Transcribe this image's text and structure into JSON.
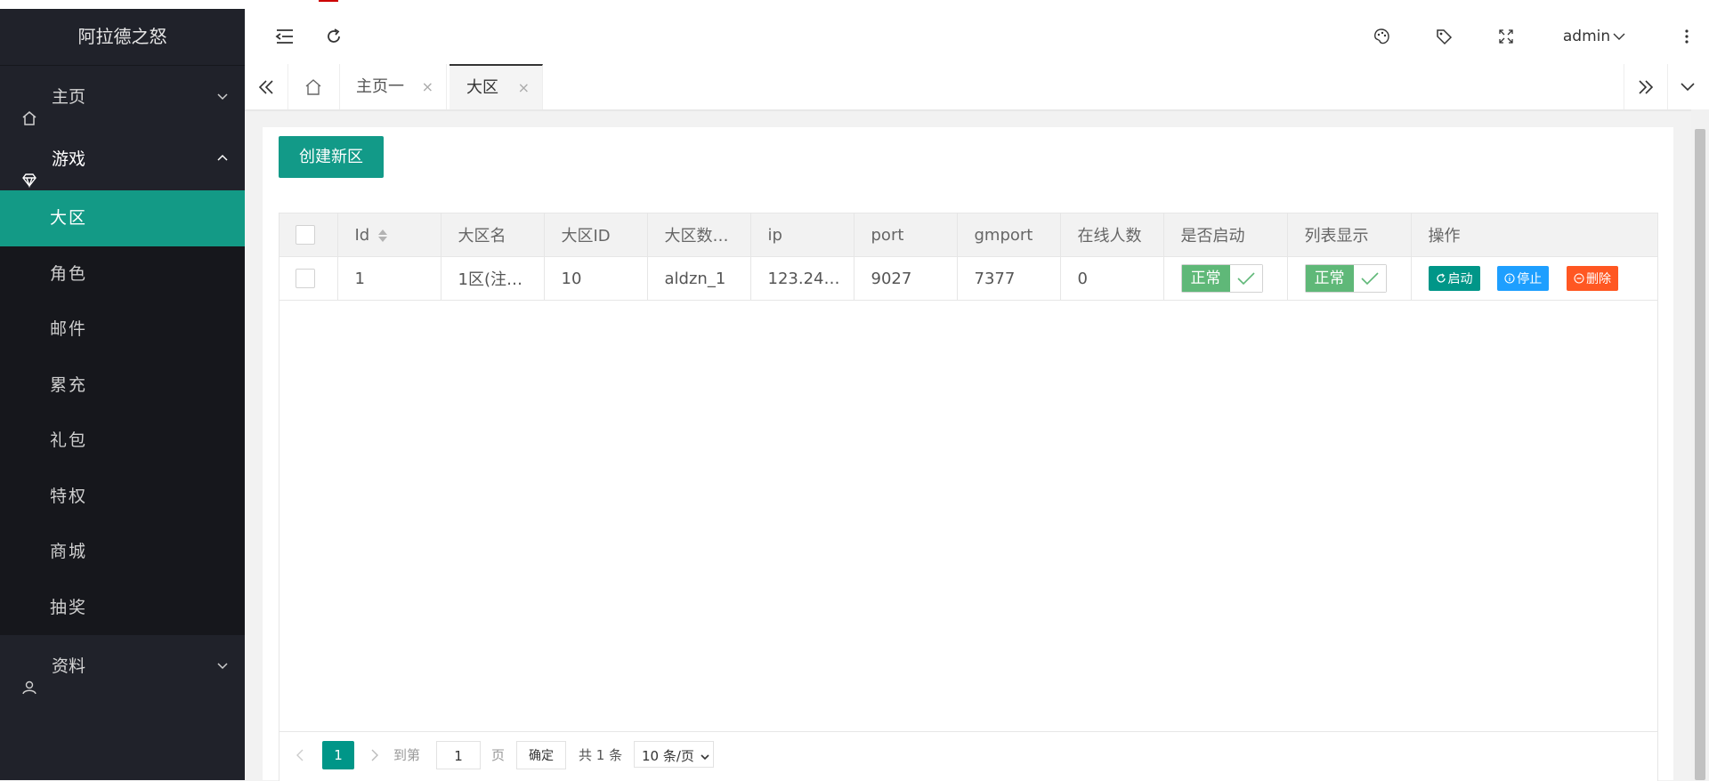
{
  "app": {
    "title": "阿拉德之怒"
  },
  "colors": {
    "accent": "#139a86",
    "sidebar": "#20222a",
    "switch_on": "#5fb878",
    "start_btn": "#009688",
    "stop_btn": "#1e9fff",
    "delete_btn": "#ff5722"
  },
  "sidebar": {
    "home": {
      "label": "主页",
      "icon": "home-icon"
    },
    "game": {
      "label": "游戏",
      "icon": "diamond-icon",
      "items": [
        {
          "label": "大区",
          "active": true
        },
        {
          "label": "角色"
        },
        {
          "label": "邮件"
        },
        {
          "label": "累充"
        },
        {
          "label": "礼包"
        },
        {
          "label": "特权"
        },
        {
          "label": "商城"
        },
        {
          "label": "抽奖"
        }
      ]
    },
    "profile": {
      "label": "资料",
      "icon": "user-icon"
    }
  },
  "header": {
    "user": "admin",
    "icons": [
      "menu-fold-icon",
      "refresh-icon",
      "theme-icon",
      "tag-icon",
      "fullscreen-icon",
      "more-icon"
    ]
  },
  "tabs": {
    "items": [
      {
        "label": "主页一"
      },
      {
        "label": "大区",
        "active": true
      }
    ]
  },
  "toolbar": {
    "create_label": "创建新区"
  },
  "table": {
    "columns": [
      "Id",
      "大区名",
      "大区ID",
      "大区数…",
      "ip",
      "port",
      "gmport",
      "在线人数",
      "是否启动",
      "列表显示",
      "操作"
    ],
    "rows": [
      {
        "id": "1",
        "name": "1区(注…",
        "zone_id": "10",
        "db": "aldzn_1",
        "ip": "123.24…",
        "port": "9027",
        "gmport": "7377",
        "online": "0",
        "started": "正常",
        "listed": "正常",
        "actions": {
          "start": "启动",
          "stop": "停止",
          "delete": "删除"
        }
      }
    ]
  },
  "pager": {
    "current": "1",
    "goto_label": "到第",
    "goto_value": "1",
    "page_suffix": "页",
    "confirm": "确定",
    "total": "共 1 条",
    "page_size": "10 条/页"
  }
}
